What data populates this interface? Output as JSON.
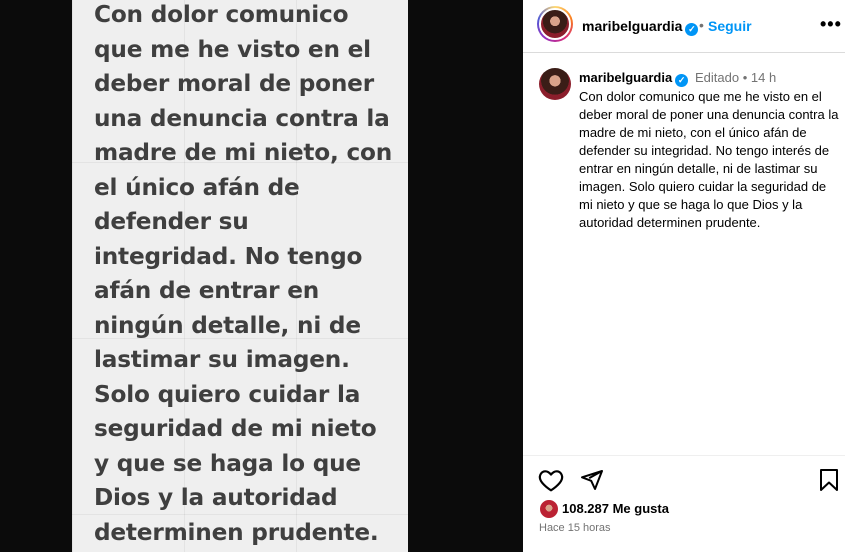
{
  "post_image": {
    "note_text": "Con dolor comunico\nque me he visto en el\ndeber moral de poner\nuna denuncia contra la\nmadre de mi nieto, con\nel único afán de\ndefender su\nintegridad.  No tengo\nafán de entrar en\nningún detalle, ni de\nlastimar su imagen.\nSolo quiero cuidar la\nseguridad de mi nieto\ny que se haga lo que\nDios y la autoridad\ndeterminen prudente."
  },
  "header": {
    "username": "maribelguardia",
    "separator": "•",
    "follow_label": "Seguir",
    "more_label": "•••"
  },
  "caption": {
    "username": "maribelguardia",
    "edited_label": "Editado",
    "separator": "•",
    "time_ago": "14 h",
    "text": "Con dolor comunico que me he visto en el deber moral de poner una denuncia contra la madre de mi nieto, con el único afán de defender su integridad. No tengo interés de entrar en ningún detalle, ni de lastimar su imagen. Solo quiero cuidar la seguridad de mi nieto y que se haga lo que Dios y la autoridad determinen prudente."
  },
  "actions": {
    "icons": [
      "heart-icon",
      "share-icon",
      "bookmark-icon"
    ]
  },
  "likes": {
    "count_text": "108.287 Me gusta"
  },
  "timestamp": "Hace 15 horas",
  "colors": {
    "link": "#0095f6",
    "muted": "#737373",
    "verified": "#0095f6"
  }
}
